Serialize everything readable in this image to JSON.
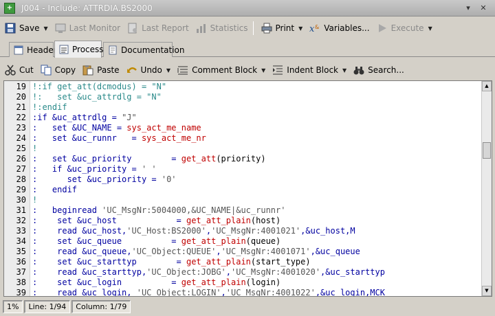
{
  "window": {
    "title": "J004 - Include: ATTRDIA.BS2000",
    "app_icon_text": "+"
  },
  "toolbar": {
    "save": "Save",
    "last_monitor": "Last Monitor",
    "last_report": "Last Report",
    "statistics": "Statistics",
    "print": "Print",
    "variables": "Variables...",
    "execute": "Execute"
  },
  "tabs": {
    "header": "Header",
    "process": "Process",
    "documentation": "Documentation"
  },
  "edit_toolbar": {
    "cut": "Cut",
    "copy": "Copy",
    "paste": "Paste",
    "undo": "Undo",
    "comment_block": "Comment Block",
    "indent_block": "Indent Block",
    "search": "Search..."
  },
  "editor": {
    "lines": [
      {
        "num": "19",
        "tokens": [
          {
            "t": "!:if ",
            "c": "teal"
          },
          {
            "t": "get_att",
            "c": "teal"
          },
          {
            "t": "(dcmodus) = ",
            "c": "teal"
          },
          {
            "t": "\"N\"",
            "c": "teal"
          }
        ]
      },
      {
        "num": "20",
        "tokens": [
          {
            "t": "!:   set &uc_attrdlg = \"N\"",
            "c": "teal"
          }
        ]
      },
      {
        "num": "21",
        "tokens": [
          {
            "t": "!:endif",
            "c": "teal"
          }
        ]
      },
      {
        "num": "22",
        "tokens": [
          {
            "t": ":if ",
            "c": "blue"
          },
          {
            "t": "&uc_attrdlg = ",
            "c": "blue"
          },
          {
            "t": "\"J\"",
            "c": "str"
          }
        ]
      },
      {
        "num": "23",
        "tokens": [
          {
            "t": ":   set &UC_NAME = ",
            "c": "blue"
          },
          {
            "t": "sys_act_me_name",
            "c": "red"
          }
        ]
      },
      {
        "num": "24",
        "tokens": [
          {
            "t": ":   set &uc_runnr   = ",
            "c": "blue"
          },
          {
            "t": "sys_act_me_nr",
            "c": "red"
          }
        ]
      },
      {
        "num": "25",
        "tokens": [
          {
            "t": "!",
            "c": "teal"
          }
        ]
      },
      {
        "num": "26",
        "tokens": [
          {
            "t": ":   set &uc_priority        = ",
            "c": "blue"
          },
          {
            "t": "get_att",
            "c": "red"
          },
          {
            "t": "(priority)",
            "c": "plain"
          }
        ]
      },
      {
        "num": "27",
        "tokens": [
          {
            "t": ":   if &uc_priority = ",
            "c": "blue"
          },
          {
            "t": "' '",
            "c": "str"
          }
        ]
      },
      {
        "num": "28",
        "tokens": [
          {
            "t": ":      set &uc_priority = ",
            "c": "blue"
          },
          {
            "t": "'0'",
            "c": "str"
          }
        ]
      },
      {
        "num": "29",
        "tokens": [
          {
            "t": ":   endif",
            "c": "blue"
          }
        ]
      },
      {
        "num": "30",
        "tokens": [
          {
            "t": "!",
            "c": "teal"
          }
        ]
      },
      {
        "num": "31",
        "tokens": [
          {
            "t": ":   beginread ",
            "c": "blue"
          },
          {
            "t": "'UC_MsgNr:5004000,&UC_NAME|&uc_runnr'",
            "c": "str"
          }
        ]
      },
      {
        "num": "32",
        "tokens": [
          {
            "t": ":    set &uc_host            = ",
            "c": "blue"
          },
          {
            "t": "get_att_plain",
            "c": "red"
          },
          {
            "t": "(host)",
            "c": "plain"
          }
        ]
      },
      {
        "num": "33",
        "tokens": [
          {
            "t": ":    read &uc_host,",
            "c": "blue"
          },
          {
            "t": "'UC_Host:BS2000'",
            "c": "str"
          },
          {
            "t": ",",
            "c": "blue"
          },
          {
            "t": "'UC_MsgNr:4001021'",
            "c": "str"
          },
          {
            "t": ",&uc_host,M",
            "c": "blue"
          }
        ]
      },
      {
        "num": "34",
        "tokens": [
          {
            "t": ":    set &uc_queue          = ",
            "c": "blue"
          },
          {
            "t": "get_att_plain",
            "c": "red"
          },
          {
            "t": "(queue)",
            "c": "plain"
          }
        ]
      },
      {
        "num": "35",
        "tokens": [
          {
            "t": ":    read &uc_queue,",
            "c": "blue"
          },
          {
            "t": "'UC_Object:QUEUE'",
            "c": "str"
          },
          {
            "t": ",",
            "c": "blue"
          },
          {
            "t": "'UC_MsgNr:4001071'",
            "c": "str"
          },
          {
            "t": ",&uc_queue",
            "c": "blue"
          }
        ]
      },
      {
        "num": "36",
        "tokens": [
          {
            "t": ":    set &uc_starttyp        = ",
            "c": "blue"
          },
          {
            "t": "get_att_plain",
            "c": "red"
          },
          {
            "t": "(start_type)",
            "c": "plain"
          }
        ]
      },
      {
        "num": "37",
        "tokens": [
          {
            "t": ":    read &uc_starttyp,",
            "c": "blue"
          },
          {
            "t": "'UC_Object:JOBG'",
            "c": "str"
          },
          {
            "t": ",",
            "c": "blue"
          },
          {
            "t": "'UC_MsgNr:4001020'",
            "c": "str"
          },
          {
            "t": ",&uc_starttyp",
            "c": "blue"
          }
        ]
      },
      {
        "num": "38",
        "tokens": [
          {
            "t": ":    set &uc_login          = ",
            "c": "blue"
          },
          {
            "t": "get_att_plain",
            "c": "red"
          },
          {
            "t": "(login)",
            "c": "plain"
          }
        ]
      },
      {
        "num": "39",
        "tokens": [
          {
            "t": ":    read &uc_login, ",
            "c": "blue"
          },
          {
            "t": "'UC_Object:LOGIN'",
            "c": "str"
          },
          {
            "t": ",",
            "c": "blue"
          },
          {
            "t": "'UC_MsgNr:4001022'",
            "c": "str"
          },
          {
            "t": ",&uc_login,MCK",
            "c": "blue"
          }
        ]
      }
    ]
  },
  "status": {
    "percent": "1%",
    "line": "Line: 1/94",
    "column": "Column: 1/79"
  }
}
